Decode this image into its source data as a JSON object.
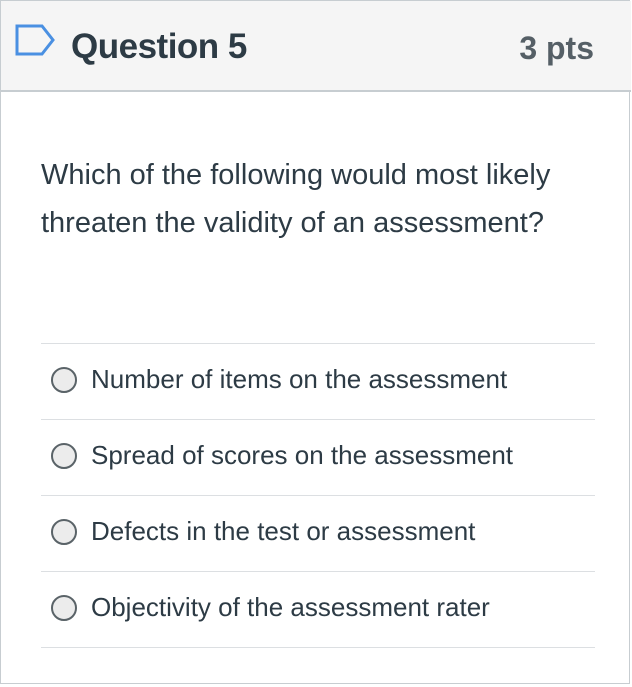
{
  "question": {
    "title": "Question 5",
    "points": "3 pts",
    "text": "Which of the following would most likely threaten the validity of an assessment?",
    "flag_icon": "bookmark-flag-icon"
  },
  "answers": [
    {
      "label": "Number of items on the assessment",
      "selected": false
    },
    {
      "label": "Spread of scores on the assessment",
      "selected": false
    },
    {
      "label": "Defects in the test or assessment",
      "selected": false
    },
    {
      "label": "Objectivity of the assessment rater",
      "selected": false
    }
  ],
  "colors": {
    "header_bg": "#f5f5f5",
    "text": "#2d3b45",
    "flag": "#4a90e2",
    "divider": "#dcdfe2"
  }
}
